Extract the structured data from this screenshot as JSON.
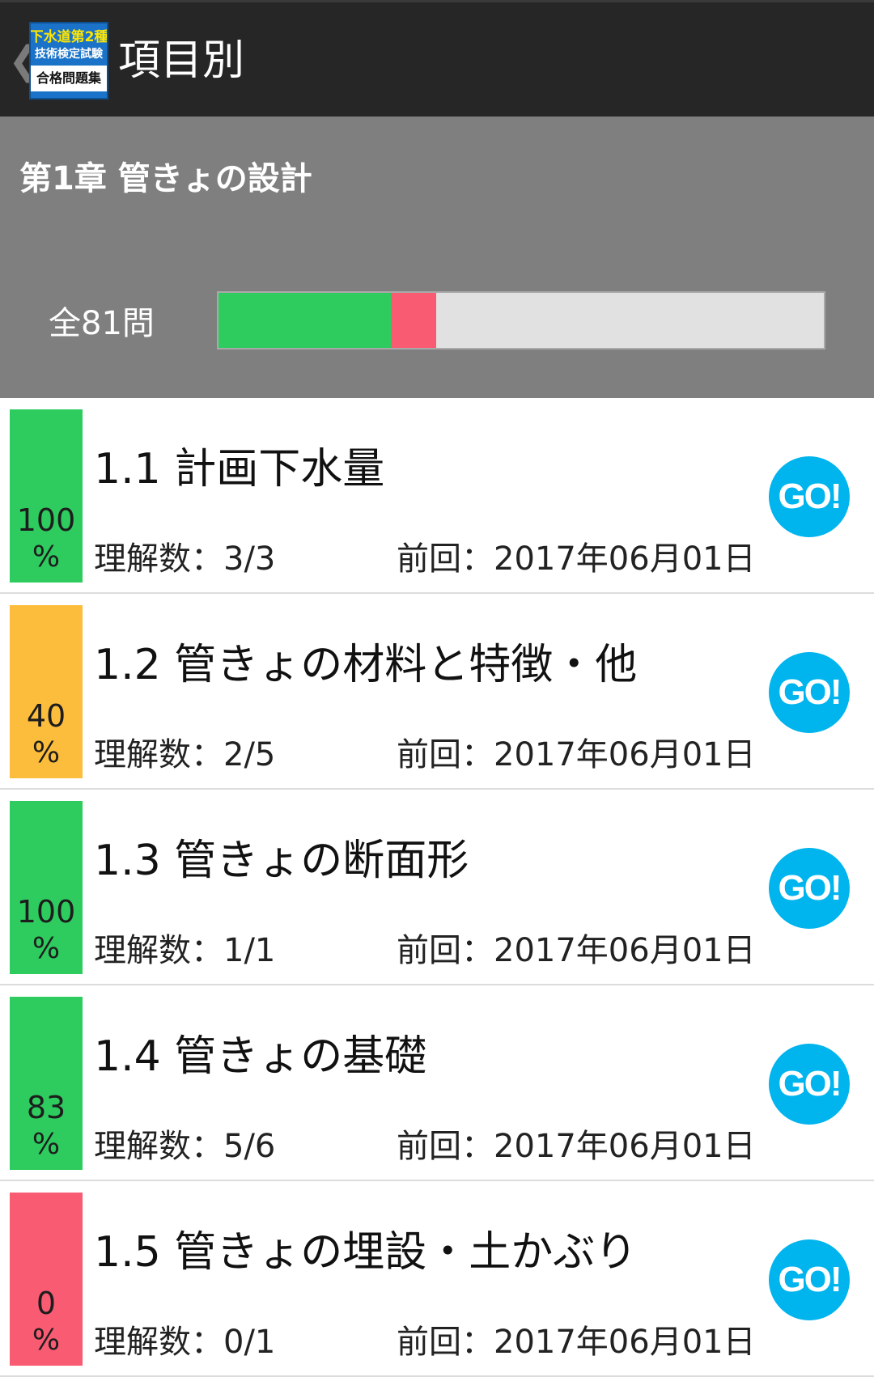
{
  "actionbar": {
    "back_glyph": "❮",
    "logo": {
      "line1": "下水道第2種",
      "line2": "技術検定試験",
      "line3": "合格問題集"
    },
    "title": "項目別"
  },
  "chapter": {
    "title": "第1章 管きょの設計",
    "total_label": "全81問",
    "progress": [
      {
        "status": "understood",
        "fraction": 0.285,
        "color": "#2ecc5f"
      },
      {
        "status": "not-understood",
        "fraction": 0.075,
        "color": "#f95b73"
      },
      {
        "status": "remaining",
        "fraction": 0.64,
        "color": "#e1e1e1"
      }
    ]
  },
  "items": [
    {
      "percent": "100",
      "unit": "%",
      "color": "#2ecc5f",
      "title": "1.1 計画下水量",
      "understood": "理解数：3/3",
      "last": "前回：2017年06月01日",
      "go": "GO!"
    },
    {
      "percent": "40",
      "unit": "%",
      "color": "#fdbd3c",
      "title": "1.2 管きょの材料と特徴・他",
      "understood": "理解数：2/5",
      "last": "前回：2017年06月01日",
      "go": "GO!"
    },
    {
      "percent": "100",
      "unit": "%",
      "color": "#2ecc5f",
      "title": "1.3 管きょの断面形",
      "understood": "理解数：1/1",
      "last": "前回：2017年06月01日",
      "go": "GO!"
    },
    {
      "percent": "83",
      "unit": "%",
      "color": "#2ecc5f",
      "title": "1.4 管きょの基礎",
      "understood": "理解数：5/6",
      "last": "前回：2017年06月01日",
      "go": "GO!"
    },
    {
      "percent": "0",
      "unit": "%",
      "color": "#f95b73",
      "title": "1.5 管きょの埋設・土かぶり",
      "understood": "理解数：0/1",
      "last": "前回：2017年06月01日",
      "go": "GO!"
    }
  ]
}
